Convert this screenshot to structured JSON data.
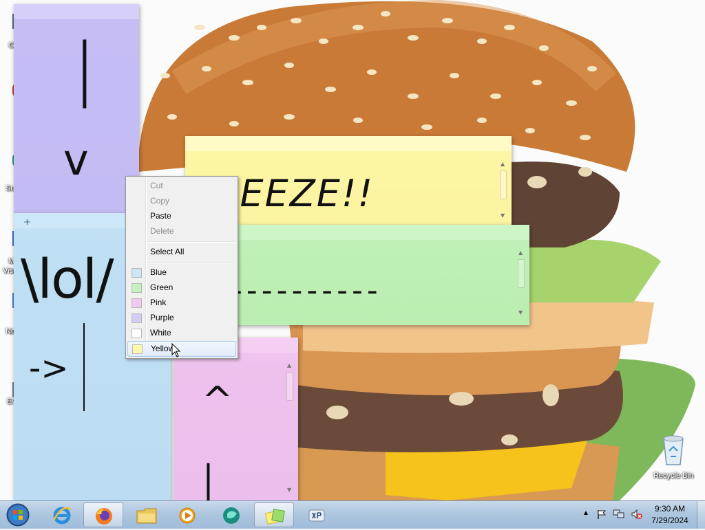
{
  "desktop": {
    "icons": [
      {
        "label": "G",
        "icon": "app-icon"
      },
      {
        "label": "Su",
        "icon": "app-icon"
      },
      {
        "label": "M",
        "icon": "app-icon"
      },
      {
        "label": "Visu",
        "icon": "app-icon"
      },
      {
        "label": "No",
        "icon": "app-icon"
      },
      {
        "label": "Ev",
        "icon": "app-icon"
      }
    ],
    "recycle_bin": {
      "label": "Recycle Bin",
      "icon": "recycle-bin-icon"
    }
  },
  "notes": {
    "purple": {
      "text_top": "|",
      "text_bottom": "v",
      "color": "#c3bbf3"
    },
    "blue": {
      "text_main": "\\lol/",
      "text_arrow": "->",
      "color": "#bcdcf3"
    },
    "yellow": {
      "text": "REEZE!!",
      "color": "#fbf3a1"
    },
    "green": {
      "text": "----------",
      "color": "#bbeeb1"
    },
    "pink": {
      "text_top": "^",
      "text_bottom": "|",
      "color": "#ecbeeb"
    }
  },
  "context_menu": {
    "items": [
      {
        "label": "Cut",
        "enabled": false
      },
      {
        "label": "Copy",
        "enabled": false
      },
      {
        "label": "Paste",
        "enabled": true
      },
      {
        "label": "Delete",
        "enabled": false
      },
      {
        "label": "Select All",
        "enabled": true
      }
    ],
    "colors": [
      {
        "label": "Blue",
        "swatch": "#c9e7f7"
      },
      {
        "label": "Green",
        "swatch": "#c4f3bd"
      },
      {
        "label": "Pink",
        "swatch": "#f4c6f2"
      },
      {
        "label": "Purple",
        "swatch": "#d3ccf7"
      },
      {
        "label": "White",
        "swatch": "#ffffff"
      },
      {
        "label": "Yellow",
        "swatch": "#fcf7a9",
        "highlighted": true
      }
    ]
  },
  "taskbar": {
    "start_icon": "windows-orb-icon",
    "buttons": [
      {
        "name": "internet-explorer",
        "icon": "internet-explorer-icon",
        "active": false
      },
      {
        "name": "firefox",
        "icon": "firefox-icon",
        "active": true
      },
      {
        "name": "file-explorer",
        "icon": "folder-icon",
        "active": false
      },
      {
        "name": "media-player",
        "icon": "media-player-icon",
        "active": false
      },
      {
        "name": "app-teal",
        "icon": "teal-app-icon",
        "active": false
      },
      {
        "name": "sticky-notes",
        "icon": "sticky-notes-icon",
        "active": true
      },
      {
        "name": "xp-app",
        "icon": "xp-icon",
        "active": false
      }
    ],
    "tray": {
      "time": "9:30 AM",
      "date": "7/29/2024"
    }
  }
}
